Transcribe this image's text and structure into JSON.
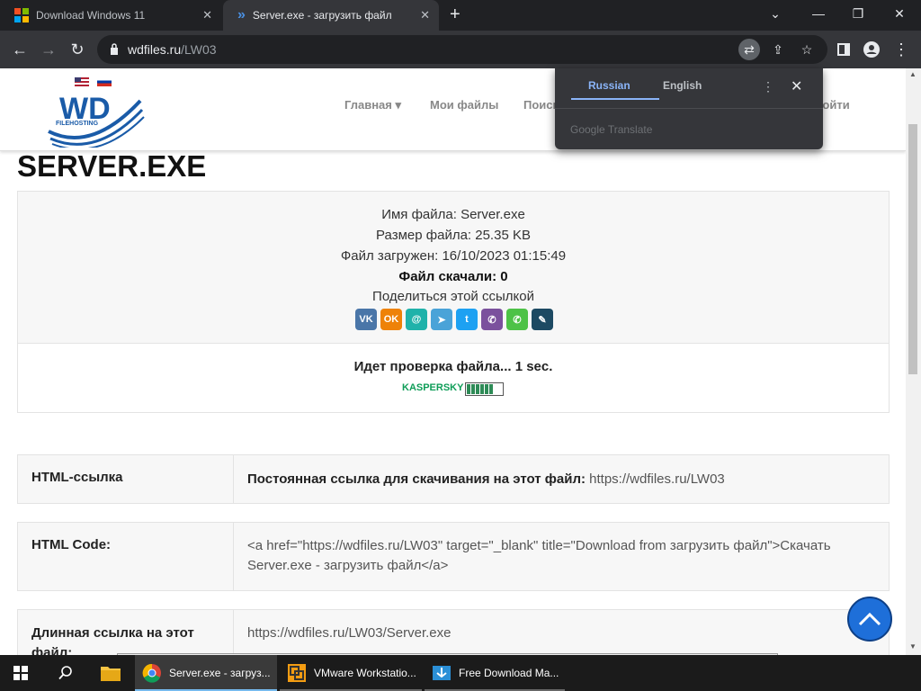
{
  "browser": {
    "tabs": [
      {
        "title": "Download Windows 11",
        "icon": "windows-logo-icon"
      },
      {
        "title": "Server.exe - загрузить файл",
        "icon": "chevron-double-right-icon"
      }
    ],
    "address": {
      "host": "wdfiles.ru",
      "path": "/LW03"
    }
  },
  "translate_popup": {
    "lang_active": "Russian",
    "lang_other": "English",
    "provider": "Google Translate"
  },
  "site": {
    "logo_text": "WD",
    "logo_sub": "FILEHOSTING",
    "nav": [
      "Главная ▾",
      "Мои файлы",
      "Поиск",
      "Войти"
    ]
  },
  "file": {
    "title": "SERVER.EXE",
    "name_line": "Имя файла: Server.exe",
    "size_line": "Размер файла: 25.35 KB",
    "uploaded_line": "Файл загружен: 16/10/2023 01:15:49",
    "downloads_line": "Файл скачали: 0",
    "share_label": "Поделиться этой ссылкой",
    "check_line": "Идет проверка файла... 1 sec.",
    "kaspersky_label": "KASPERSKY"
  },
  "share_icons": [
    {
      "name": "vk-icon",
      "glyph": "VK",
      "color": "#4a76a8"
    },
    {
      "name": "odnoklassniki-icon",
      "glyph": "OK",
      "color": "#ee8208"
    },
    {
      "name": "moimir-icon",
      "glyph": "@",
      "color": "#20b2aa"
    },
    {
      "name": "telegram-icon",
      "glyph": "➤",
      "color": "#4aa3d8"
    },
    {
      "name": "twitter-icon",
      "glyph": "t",
      "color": "#1da1f2"
    },
    {
      "name": "viber-icon",
      "glyph": "✆",
      "color": "#7b519d"
    },
    {
      "name": "whatsapp-icon",
      "glyph": "✆",
      "color": "#4dc247"
    },
    {
      "name": "livejournal-icon",
      "glyph": "✎",
      "color": "#1d4a63"
    }
  ],
  "rows": [
    {
      "label": "HTML-ссылка",
      "bold_text": "Постоянная ссылка для скачивания на этот файл: ",
      "text": "https://wdfiles.ru/LW03"
    },
    {
      "label": "HTML Code:",
      "bold_text": "",
      "text": "<a href=\"https://wdfiles.ru/LW03\" target=\"_blank\" title=\"Download from загрузить файл\">Скачать Server.exe - загрузить файл</a>"
    },
    {
      "label": "Длинная ссылка на этот файл:",
      "bold_text": "",
      "text": "https://wdfiles.ru/LW03/Server.exe"
    }
  ],
  "taskbar": {
    "apps": [
      "Server.exe - загруз...",
      "VMware Workstatio...",
      "Free Download Ma..."
    ]
  }
}
